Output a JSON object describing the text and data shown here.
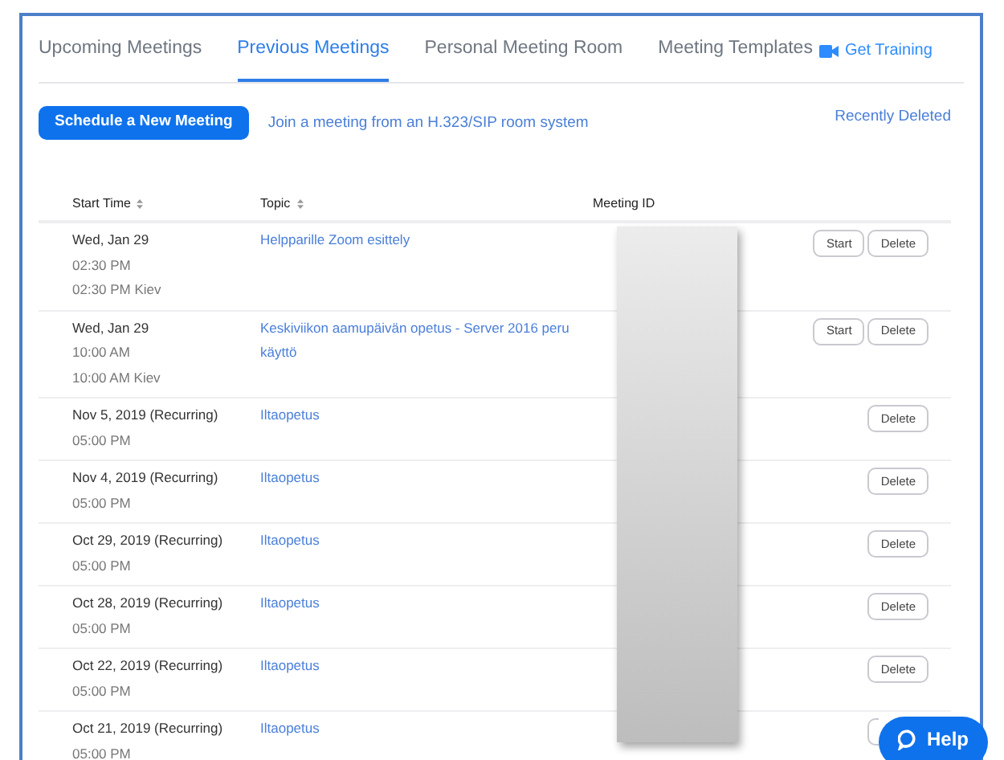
{
  "tabs": [
    {
      "label": "Upcoming Meetings",
      "selected": false
    },
    {
      "label": "Previous Meetings",
      "selected": true
    },
    {
      "label": "Personal Meeting Room",
      "selected": false
    },
    {
      "label": "Meeting Templates",
      "selected": false
    }
  ],
  "training_link": "Get Training",
  "schedule_button": "Schedule a New Meeting",
  "join_link": "Join a meeting from an H.323/SIP room system",
  "recently_deleted_link": "Recently Deleted",
  "table": {
    "columns": [
      {
        "label": "Start Time",
        "sortable": true
      },
      {
        "label": "Topic",
        "sortable": true
      },
      {
        "label": "Meeting ID",
        "sortable": false
      }
    ],
    "rows": [
      {
        "start": [
          "Wed, Jan 29",
          "02:30 PM",
          "02:30 PM Kiev"
        ],
        "topic": [
          "Helpparille Zoom esittely"
        ],
        "actions": [
          "Start",
          "Delete"
        ]
      },
      {
        "start": [
          "Wed, Jan 29",
          "10:00 AM",
          "10:00 AM Kiev"
        ],
        "topic": [
          "Keskiviikon aamupäivän opetus - Server 2016 peru",
          "käyttö"
        ],
        "actions": [
          "Start",
          "Delete"
        ]
      },
      {
        "start": [
          "Nov 5, 2019 (Recurring)",
          "05:00 PM"
        ],
        "topic": [
          "Iltaopetus"
        ],
        "actions": [
          "Delete"
        ]
      },
      {
        "start": [
          "Nov 4, 2019 (Recurring)",
          "05:00 PM"
        ],
        "topic": [
          "Iltaopetus"
        ],
        "actions": [
          "Delete"
        ]
      },
      {
        "start": [
          "Oct 29, 2019 (Recurring)",
          "05:00 PM"
        ],
        "topic": [
          "Iltaopetus"
        ],
        "actions": [
          "Delete"
        ]
      },
      {
        "start": [
          "Oct 28, 2019 (Recurring)",
          "05:00 PM"
        ],
        "topic": [
          "Iltaopetus"
        ],
        "actions": [
          "Delete"
        ]
      },
      {
        "start": [
          "Oct 22, 2019 (Recurring)",
          "05:00 PM"
        ],
        "topic": [
          "Iltaopetus"
        ],
        "actions": [
          "Delete"
        ]
      },
      {
        "start": [
          "Oct 21, 2019 (Recurring)",
          "05:00 PM"
        ],
        "topic": [
          "Iltaopetus"
        ],
        "covered_button": true
      }
    ]
  },
  "help_button": "Help"
}
